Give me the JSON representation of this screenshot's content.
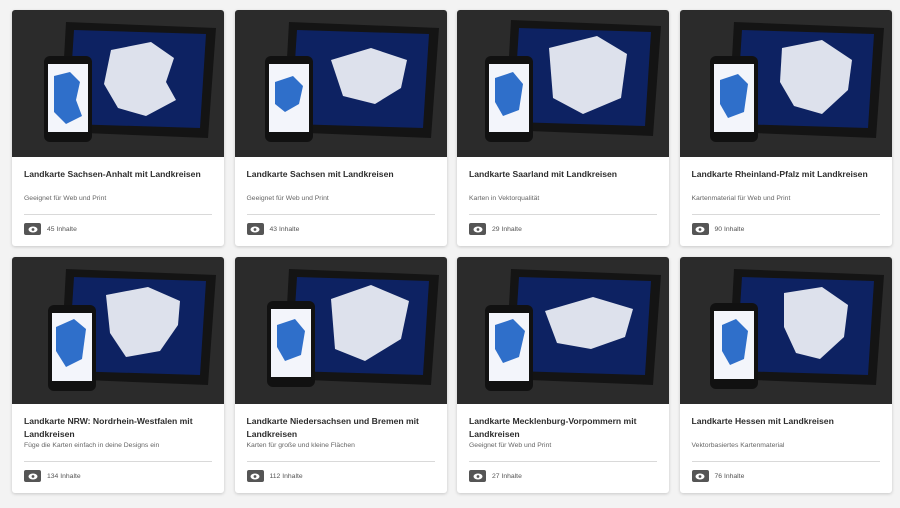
{
  "cards": [
    {
      "title": "Landkarte Sachsen-Anhalt mit Landkreisen",
      "desc": "Geeignet für Web und Print",
      "count": "45 Inhalte",
      "icon": "eye-icon"
    },
    {
      "title": "Landkarte Sachsen mit Landkreisen",
      "desc": "Geeignet für Web und Print",
      "count": "43 Inhalte",
      "icon": "eye-icon"
    },
    {
      "title": "Landkarte Saarland mit Landkreisen",
      "desc": "Karten in Vektorqualität",
      "count": "29 Inhalte",
      "icon": "eye-icon"
    },
    {
      "title": "Landkarte Rheinland-Pfalz mit Landkreisen",
      "desc": "Kartenmaterial für Web und Print",
      "count": "90 Inhalte",
      "icon": "eye-icon"
    },
    {
      "title": "Landkarte NRW: Nordrhein-Westfalen mit Landkreisen",
      "desc": "Füge die Karten einfach in deine Designs ein",
      "count": "134 Inhalte",
      "icon": "eye-icon"
    },
    {
      "title": "Landkarte Niedersachsen und Bremen mit Landkreisen",
      "desc": "Karten für große und kleine Flächen",
      "count": "112 Inhalte",
      "icon": "eye-icon"
    },
    {
      "title": "Landkarte Mecklenburg-Vorpommern mit Landkreisen",
      "desc": "Geeignet für Web und Print",
      "count": "27 Inhalte",
      "icon": "eye-icon"
    },
    {
      "title": "Landkarte Hessen mit Landkreisen",
      "desc": "Vektorbasiertes Kartenmaterial",
      "count": "76 Inhalte",
      "icon": "eye-icon"
    }
  ],
  "colors": {
    "map_blue": "#0b1f5c",
    "phone_map": "#2a7fd0",
    "background": "#2a2a2a"
  }
}
